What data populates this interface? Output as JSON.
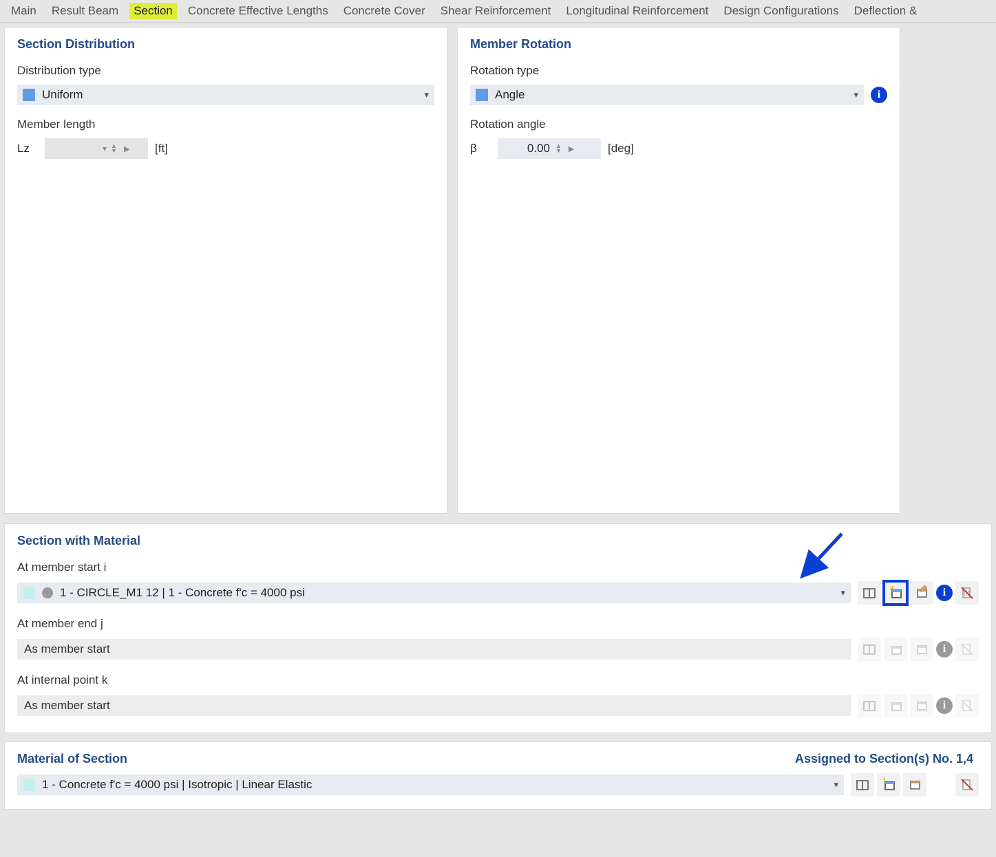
{
  "tabs": [
    {
      "label": "Main",
      "active": false
    },
    {
      "label": "Result Beam",
      "active": false
    },
    {
      "label": "Section",
      "active": true
    },
    {
      "label": "Concrete Effective Lengths",
      "active": false
    },
    {
      "label": "Concrete Cover",
      "active": false
    },
    {
      "label": "Shear Reinforcement",
      "active": false
    },
    {
      "label": "Longitudinal Reinforcement",
      "active": false
    },
    {
      "label": "Design Configurations",
      "active": false
    },
    {
      "label": "Deflection &",
      "active": false
    }
  ],
  "section_distribution": {
    "title": "Section Distribution",
    "distribution_type_label": "Distribution type",
    "distribution_type_value": "Uniform",
    "member_length_label": "Member length",
    "member_length_symbol": "Lz",
    "member_length_value": "",
    "member_length_unit": "[ft]"
  },
  "member_rotation": {
    "title": "Member Rotation",
    "rotation_type_label": "Rotation type",
    "rotation_type_value": "Angle",
    "rotation_angle_label": "Rotation angle",
    "rotation_angle_symbol": "β",
    "rotation_angle_value": "0.00",
    "rotation_angle_unit": "[deg]"
  },
  "section_with_material": {
    "title": "Section with Material",
    "at_start_label": "At member start i",
    "at_start_value": "1 - CIRCLE_M1 12 | 1 - Concrete f'c = 4000 psi",
    "at_end_label": "At member end j",
    "at_end_value": "As member start",
    "at_internal_label": "At internal point k",
    "at_internal_value": "As member start"
  },
  "material_of_section": {
    "title": "Material of Section",
    "assigned_label": "Assigned to Section(s) No. 1,4",
    "value": "1 - Concrete f'c = 4000 psi | Isotropic | Linear Elastic"
  },
  "icons": {
    "library": "library-icon",
    "new": "new-icon",
    "edit": "edit-icon",
    "info": "info-icon",
    "delete": "delete-icon"
  }
}
